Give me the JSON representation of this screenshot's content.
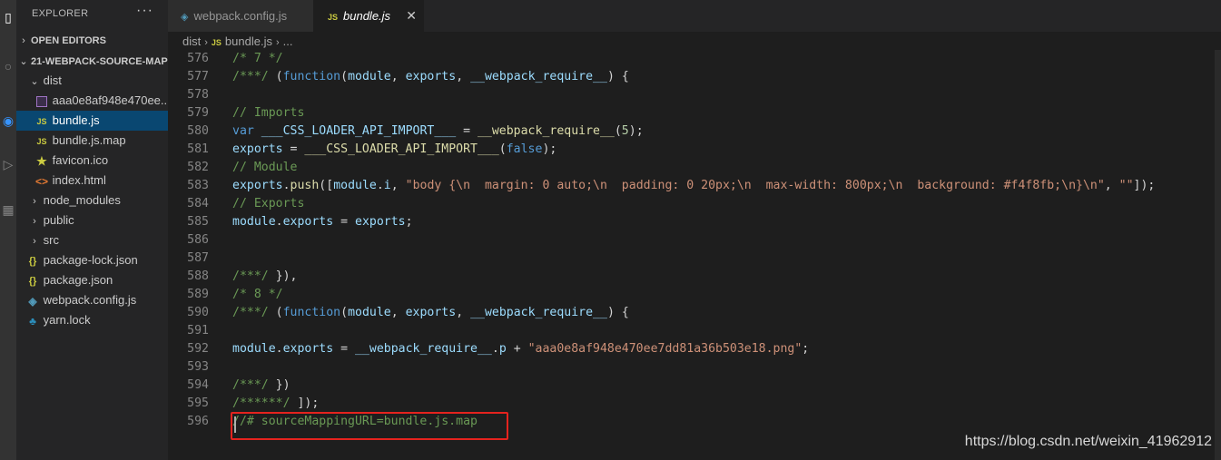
{
  "sidebar": {
    "title": "EXPLORER",
    "more": "···",
    "open_editors": "OPEN EDITORS",
    "project": "21-WEBPACK-SOURCE-MAP",
    "items": [
      {
        "label": "dist",
        "icon": "folder-open-chevron",
        "kind": "folder-open"
      },
      {
        "label": "aaa0e8af948e470ee...",
        "icon": "image-file-icon",
        "kind": "png"
      },
      {
        "label": "bundle.js",
        "icon": "js-file-icon",
        "kind": "js"
      },
      {
        "label": "bundle.js.map",
        "icon": "js-file-icon",
        "kind": "js"
      },
      {
        "label": "favicon.ico",
        "icon": "star-icon",
        "kind": "star"
      },
      {
        "label": "index.html",
        "icon": "html-file-icon",
        "kind": "html"
      },
      {
        "label": "node_modules",
        "icon": "folder-closed-chevron",
        "kind": "folder"
      },
      {
        "label": "public",
        "icon": "folder-closed-chevron",
        "kind": "folder"
      },
      {
        "label": "src",
        "icon": "folder-closed-chevron",
        "kind": "folder"
      },
      {
        "label": "package-lock.json",
        "icon": "json-file-icon",
        "kind": "json"
      },
      {
        "label": "package.json",
        "icon": "json-file-icon",
        "kind": "json"
      },
      {
        "label": "webpack.config.js",
        "icon": "webpack-cube-icon",
        "kind": "cube"
      },
      {
        "label": "yarn.lock",
        "icon": "yarn-icon",
        "kind": "yarn"
      }
    ]
  },
  "tabs": [
    {
      "label": "webpack.config.js",
      "icon": "webpack-cube-icon",
      "active": false
    },
    {
      "label": "bundle.js",
      "icon_text": "JS",
      "active": true,
      "close": "✕"
    }
  ],
  "breadcrumb": {
    "folder": "dist",
    "file_icon": "JS",
    "file": "bundle.js",
    "tail": "..."
  },
  "colors": {
    "comment": "#6a9955",
    "keyword": "#569cd6",
    "variable": "#9cdcfe",
    "function": "#dcdcaa",
    "string": "#ce9178",
    "highlight_border": "#e5231e",
    "selection": "#094771"
  },
  "code_lines": [
    {
      "n": "576",
      "tokens": [
        [
          "c",
          "/* 7 */"
        ]
      ]
    },
    {
      "n": "577",
      "tokens": [
        [
          "c",
          "/***/ "
        ],
        [
          "p",
          "("
        ],
        [
          "k",
          "function"
        ],
        [
          "p",
          "("
        ],
        [
          "v",
          "module"
        ],
        [
          "p",
          ", "
        ],
        [
          "v",
          "exports"
        ],
        [
          "p",
          ", "
        ],
        [
          "v",
          "__webpack_require__"
        ],
        [
          "p",
          ") {"
        ]
      ]
    },
    {
      "n": "578",
      "tokens": []
    },
    {
      "n": "579",
      "tokens": [
        [
          "c",
          "// Imports"
        ]
      ]
    },
    {
      "n": "580",
      "tokens": [
        [
          "k",
          "var"
        ],
        [
          "p",
          " "
        ],
        [
          "v",
          "___CSS_LOADER_API_IMPORT___"
        ],
        [
          "p",
          " = "
        ],
        [
          "f",
          "__webpack_require__"
        ],
        [
          "p",
          "("
        ],
        [
          "n",
          "5"
        ],
        [
          "p",
          ");"
        ]
      ]
    },
    {
      "n": "581",
      "tokens": [
        [
          "v",
          "exports"
        ],
        [
          "p",
          " = "
        ],
        [
          "f",
          "___CSS_LOADER_API_IMPORT___"
        ],
        [
          "p",
          "("
        ],
        [
          "k",
          "false"
        ],
        [
          "p",
          ");"
        ]
      ]
    },
    {
      "n": "582",
      "tokens": [
        [
          "c",
          "// Module"
        ]
      ]
    },
    {
      "n": "583",
      "tokens": [
        [
          "v",
          "exports"
        ],
        [
          "p",
          "."
        ],
        [
          "f",
          "push"
        ],
        [
          "p",
          "(["
        ],
        [
          "v",
          "module"
        ],
        [
          "p",
          "."
        ],
        [
          "v",
          "i"
        ],
        [
          "p",
          ", "
        ],
        [
          "s",
          "\"body {\\n  margin: 0 auto;\\n  padding: 0 20px;\\n  max-width: 800px;\\n  background: #f4f8fb;\\n}\\n\""
        ],
        [
          "p",
          ", "
        ],
        [
          "s",
          "\"\""
        ],
        [
          "p",
          "]);"
        ]
      ]
    },
    {
      "n": "584",
      "tokens": [
        [
          "c",
          "// Exports"
        ]
      ]
    },
    {
      "n": "585",
      "tokens": [
        [
          "v",
          "module"
        ],
        [
          "p",
          "."
        ],
        [
          "v",
          "exports"
        ],
        [
          "p",
          " = "
        ],
        [
          "v",
          "exports"
        ],
        [
          "p",
          ";"
        ]
      ]
    },
    {
      "n": "586",
      "tokens": []
    },
    {
      "n": "587",
      "tokens": []
    },
    {
      "n": "588",
      "tokens": [
        [
          "c",
          "/***/ "
        ],
        [
          "p",
          "}),"
        ]
      ]
    },
    {
      "n": "589",
      "tokens": [
        [
          "c",
          "/* 8 */"
        ]
      ]
    },
    {
      "n": "590",
      "tokens": [
        [
          "c",
          "/***/ "
        ],
        [
          "p",
          "("
        ],
        [
          "k",
          "function"
        ],
        [
          "p",
          "("
        ],
        [
          "v",
          "module"
        ],
        [
          "p",
          ", "
        ],
        [
          "v",
          "exports"
        ],
        [
          "p",
          ", "
        ],
        [
          "v",
          "__webpack_require__"
        ],
        [
          "p",
          ") {"
        ]
      ]
    },
    {
      "n": "591",
      "tokens": []
    },
    {
      "n": "592",
      "tokens": [
        [
          "v",
          "module"
        ],
        [
          "p",
          "."
        ],
        [
          "v",
          "exports"
        ],
        [
          "p",
          " = "
        ],
        [
          "v",
          "__webpack_require__"
        ],
        [
          "p",
          "."
        ],
        [
          "v",
          "p"
        ],
        [
          "p",
          " + "
        ],
        [
          "s",
          "\"aaa0e8af948e470ee7dd81a36b503e18.png\""
        ],
        [
          "p",
          ";"
        ]
      ]
    },
    {
      "n": "593",
      "tokens": []
    },
    {
      "n": "594",
      "tokens": [
        [
          "c",
          "/***/ "
        ],
        [
          "p",
          "})"
        ]
      ]
    },
    {
      "n": "595",
      "tokens": [
        [
          "c",
          "/******/ "
        ],
        [
          "p",
          "]);"
        ]
      ]
    },
    {
      "n": "596",
      "tokens": [
        [
          "c",
          "//# sourceMappingURL=bundle.js.map"
        ]
      ]
    }
  ],
  "watermark": "https://blog.csdn.net/weixin_41962912"
}
